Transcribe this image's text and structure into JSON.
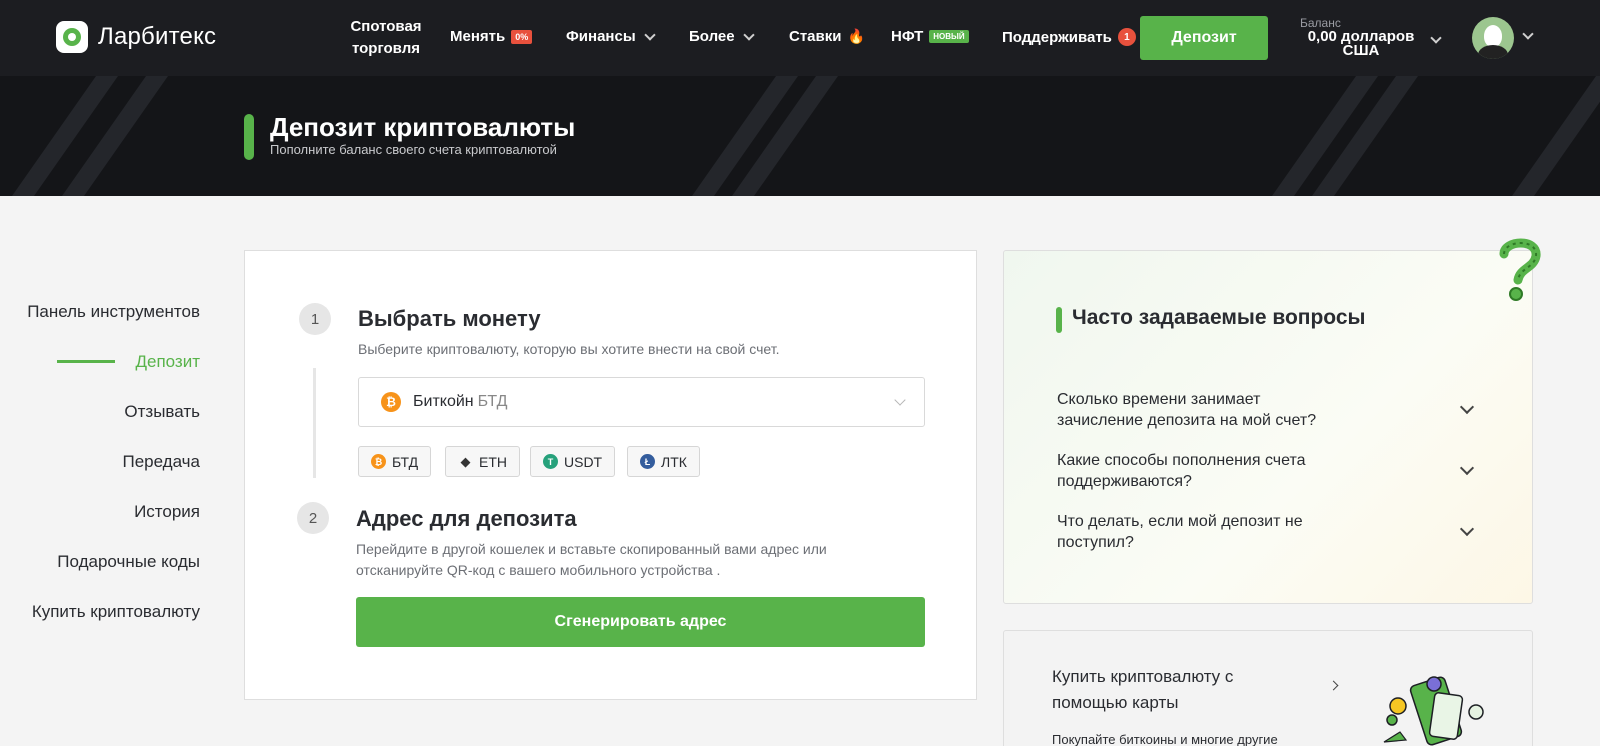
{
  "header": {
    "brand": "Ларбитекс",
    "nav": {
      "spot": "Спотовая торговля",
      "change": "Менять",
      "change_badge": "0%",
      "finance": "Финансы",
      "more": "Более",
      "bets": "Ставки",
      "nft": "НФТ",
      "nft_badge": "НОВЫЙ",
      "support": "Поддерживать",
      "support_count": "1"
    },
    "deposit_button": "Депозит",
    "balance_label": "Баланс",
    "balance_value": "0,00 долларов США"
  },
  "hero": {
    "title": "Депозит криптовалюты",
    "subtitle": "Пополните баланс своего счета криптовалютой"
  },
  "sidebar": {
    "items": [
      {
        "label": "Панель инструментов",
        "active": false
      },
      {
        "label": "Депозит",
        "active": true
      },
      {
        "label": "Отзывать",
        "active": false
      },
      {
        "label": "Передача",
        "active": false
      },
      {
        "label": "История",
        "active": false
      },
      {
        "label": "Подарочные коды",
        "active": false
      },
      {
        "label": "Купить криптовалюту",
        "active": false
      }
    ]
  },
  "step1": {
    "number": "1",
    "title": "Выбрать монету",
    "description": "Выберите криптовалюту, которую вы хотите внести на свой счет.",
    "selected_coin": "Биткойн",
    "selected_ticker": "БТД",
    "quick_coins": [
      {
        "label": "БТД",
        "icon": "bitcoin-icon",
        "color": "#f7931a"
      },
      {
        "label": "ETH",
        "icon": "ethereum-icon",
        "color": "#343434"
      },
      {
        "label": "USDT",
        "icon": "tether-icon",
        "color": "#26a17b"
      },
      {
        "label": "ЛТК",
        "icon": "litecoin-icon",
        "color": "#345d9d"
      }
    ]
  },
  "step2": {
    "number": "2",
    "title": "Адрес для депозита",
    "description_line1": "Перейдите в другой кошелек и вставьте скопированный вами адрес или",
    "description_line2": "отсканируйте QR-код с вашего мобильного устройства .",
    "button": "Сгенерировать адрес"
  },
  "faq": {
    "title": "Часто задаваемые вопросы",
    "questions": [
      {
        "line1": "Сколько времени занимает",
        "line2": "зачисление депозита на мой счет?"
      },
      {
        "line1": "Какие способы пополнения счета",
        "line2": "поддерживаются?"
      },
      {
        "line1": "Что делать, если мой депозит не",
        "line2": "поступил?"
      }
    ]
  },
  "buy": {
    "title_line1": "Купить криптовалюту с",
    "title_line2": "помощью карты",
    "subtitle": "Покупайте биткоины и многие другие"
  },
  "colors": {
    "accent": "#58b34a",
    "topbar": "#1c1d21",
    "badge_red": "#e8513d"
  }
}
